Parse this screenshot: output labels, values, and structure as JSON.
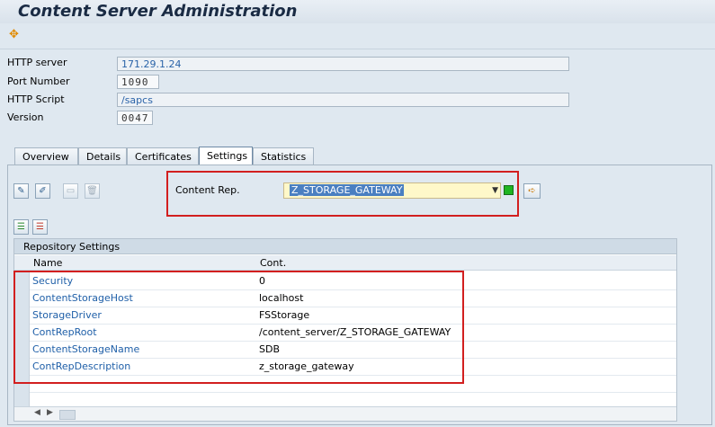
{
  "window": {
    "title": "Content Server Administration"
  },
  "toolbar": {
    "icon": "transport-icon"
  },
  "fields": [
    {
      "label": "HTTP server",
      "value": "171.29.1.24"
    },
    {
      "label": "Port Number",
      "value": "1090"
    },
    {
      "label": "HTTP Script",
      "value": "/sapcs"
    },
    {
      "label": "Version",
      "value": "0047"
    }
  ],
  "tabs": [
    {
      "label": "Overview"
    },
    {
      "label": "Details"
    },
    {
      "label": "Certificates"
    },
    {
      "label": "Settings"
    },
    {
      "label": "Statistics"
    }
  ],
  "content_rep": {
    "label": "Content Rep.",
    "value": "Z_STORAGE_GATEWAY",
    "status_color": "#1fb522"
  },
  "table": {
    "title": "Repository Settings",
    "columns": [
      "Name",
      "Cont."
    ],
    "rows": [
      {
        "name": "Security",
        "value": "0"
      },
      {
        "name": "ContentStorageHost",
        "value": "localhost"
      },
      {
        "name": "StorageDriver",
        "value": "FSStorage"
      },
      {
        "name": "ContRepRoot",
        "value": "/content_server/Z_STORAGE_GATEWAY"
      },
      {
        "name": "ContentStorageName",
        "value": "SDB"
      },
      {
        "name": "ContRepDescription",
        "value": "z_storage_gateway"
      }
    ]
  },
  "colors": {
    "highlight": "#d21f1f",
    "link": "#1f5fa8"
  }
}
